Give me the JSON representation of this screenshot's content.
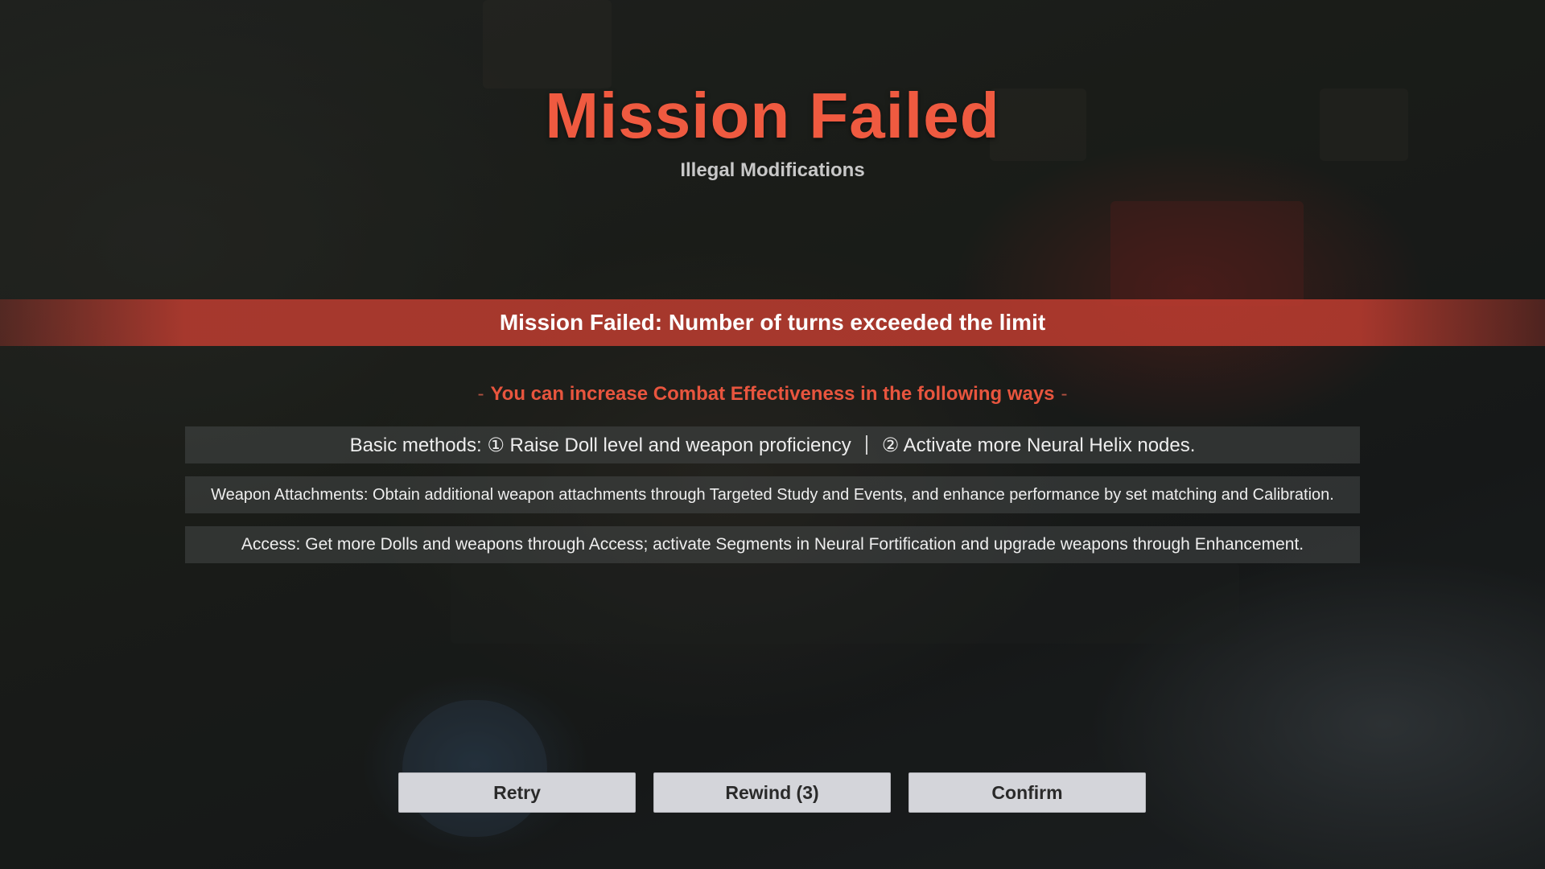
{
  "result": {
    "title": "Mission Failed",
    "subtitle": "Illegal Modifications"
  },
  "failure_reason": "Mission Failed: Number of turns exceeded the limit",
  "tips": {
    "heading_prefix": "-",
    "heading": "You can increase Combat Effectiveness in the following ways",
    "heading_suffix": "-",
    "basic_part1": "Basic methods: ① Raise Doll level and weapon proficiency",
    "basic_part2": "② Activate more Neural Helix nodes.",
    "attachments": "Weapon Attachments: Obtain additional weapon attachments through Targeted Study and Events, and enhance performance by set matching and Calibration.",
    "access": "Access: Get more Dolls and weapons through Access; activate Segments in Neural Fortification and upgrade weapons through Enhancement."
  },
  "buttons": {
    "retry": "Retry",
    "rewind": "Rewind (3)",
    "confirm": "Confirm"
  },
  "colors": {
    "title": "#ef5a40",
    "banner": "#be3c30",
    "tips_heading": "#e8553e",
    "button_bg": "#d4d5da"
  }
}
